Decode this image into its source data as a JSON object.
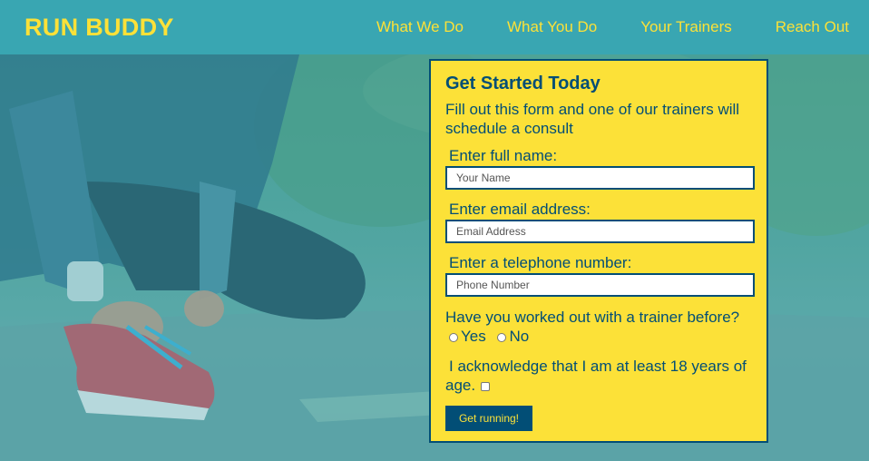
{
  "header": {
    "logo": "RUN BUDDY",
    "nav": [
      "What We Do",
      "What You Do",
      "Your Trainers",
      "Reach Out"
    ]
  },
  "form": {
    "title": "Get Started Today",
    "intro": "Fill out this form and one of our trainers will schedule a consult",
    "name_label": "Enter full name:",
    "name_placeholder": "Your Name",
    "email_label": "Enter email address:",
    "email_placeholder": "Email Address",
    "phone_label": "Enter a telephone number:",
    "phone_placeholder": "Phone Number",
    "trainer_question": "Have you worked out with a trainer before?",
    "yes_label": "Yes",
    "no_label": "No",
    "age_ack": "I acknowledge that I am at least 18 years of age.",
    "submit_label": "Get running!"
  },
  "colors": {
    "brand_teal": "#39a6b2",
    "brand_yellow": "#fce138",
    "brand_navy": "#024e76"
  }
}
